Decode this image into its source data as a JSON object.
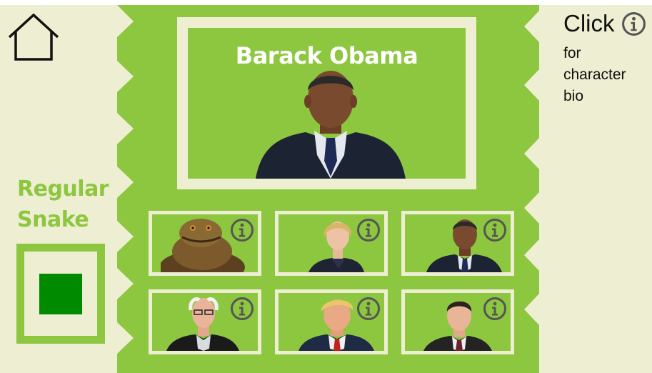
{
  "colors": {
    "green": "#8dc63f",
    "cream": "#eeeed2",
    "dark_green": "#008a00",
    "icon_gray": "#555555"
  },
  "home": {
    "icon": "home-icon"
  },
  "snake": {
    "line1": "Regular",
    "line2": "Snake",
    "swatch_color": "#008a00"
  },
  "featured": {
    "name": "Barack Obama",
    "portrait": "obama"
  },
  "characters": [
    {
      "id": "jabba",
      "portrait": "jabba",
      "info_icon": "info-icon"
    },
    {
      "id": "hillary",
      "portrait": "hillary",
      "info_icon": "info-icon"
    },
    {
      "id": "obama",
      "portrait": "obama",
      "info_icon": "info-icon"
    },
    {
      "id": "bernie",
      "portrait": "bernie",
      "info_icon": "info-icon"
    },
    {
      "id": "trump",
      "portrait": "trump",
      "info_icon": "info-icon"
    },
    {
      "id": "cruz",
      "portrait": "cruz",
      "info_icon": "info-icon"
    }
  ],
  "hint": {
    "click": "Click",
    "line1": "for",
    "line2": "character",
    "line3": "bio",
    "icon": "info-icon"
  }
}
